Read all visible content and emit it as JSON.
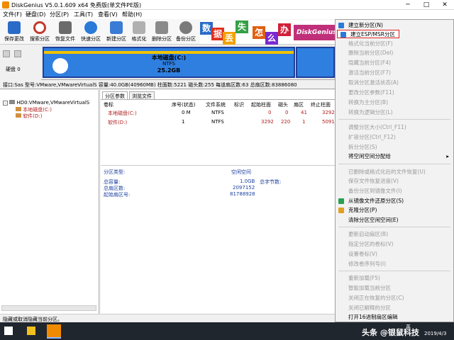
{
  "window": {
    "title": "DiskGenius V5.0.1.609 x64 免费版(单文件PE版)",
    "min": "─",
    "max": "□",
    "close": "✕"
  },
  "menu": [
    "文件(F)",
    "硬盘(D)",
    "分区(P)",
    "工具(T)",
    "查看(V)",
    "帮助(H)"
  ],
  "toolbar": [
    {
      "label": "保存更改",
      "color": "#2a6bc8"
    },
    {
      "label": "搜索分区",
      "color": "#c23a2a"
    },
    {
      "label": "恢复文件",
      "color": "#6b6b6b"
    },
    {
      "label": "快速分区",
      "color": "#2a7ad8"
    },
    {
      "label": "新建分区",
      "color": "#3a7bd5"
    },
    {
      "label": "格式化",
      "color": "#b0b0b0"
    },
    {
      "label": "删除分区",
      "color": "#8a8a8a"
    },
    {
      "label": "备份分区",
      "color": "#7a7a7a"
    }
  ],
  "banner": {
    "chars": [
      "数",
      "据",
      "丢",
      "失",
      "怎",
      "么",
      "办"
    ],
    "colors": [
      "#2a6bc8",
      "#e0301f",
      "#f2a000",
      "#33a047",
      "#e06010",
      "#7a2ad0",
      "#d0203a"
    ],
    "brand": "DiskGenius"
  },
  "disk_panel": {
    "label": "硬盘 0"
  },
  "partition_bar": {
    "name": "本地磁盘(C:)",
    "fs": "NTFS",
    "size": "25.2GB"
  },
  "disk_info": "接口:Sas  型号:VMware,VMwareVirtualS  容量:40.0GB(40960MB)  柱面数:5221  磁头数:255  每道扇区数:63  总扇区数:83886080",
  "tree": {
    "disk": "HD0:VMware,VMwareVirtualS",
    "items": [
      "本地磁盘(C:)",
      "软件(D:)"
    ]
  },
  "tabs": [
    "分区参数",
    "浏览文件"
  ],
  "table": {
    "headers": [
      "卷标",
      "序号(状态)",
      "文件系统",
      "标识",
      "起始柱面",
      "磁头",
      "扇区",
      "终止柱面"
    ],
    "rows": [
      [
        "本地磁盘(C:)",
        "0 M",
        "NTFS",
        "",
        "0",
        "0",
        "41",
        "3292"
      ],
      [
        "软件(D:)",
        "1",
        "NTFS",
        "",
        "3292",
        "220",
        "1",
        "5091"
      ]
    ]
  },
  "details": {
    "type_label": "分区类型:",
    "type_value": "空闲空间",
    "total_label": "总容量:",
    "total_value": "1.0GB",
    "sectors_label": "总扇区数:",
    "sectors_value": "2097152",
    "start_label": "起始扇区号:",
    "start_value": "81788928",
    "bytes_label": "总字节数:"
  },
  "status": "隐藏或取消隐藏当前分区。",
  "context_menu": [
    {
      "label": "建立新分区(N)",
      "disabled": false,
      "icon": "#2a7ad8"
    },
    {
      "label": "建立ESP/MSR分区",
      "disabled": false,
      "icon": "#2a7ad8",
      "highlight": true
    },
    {
      "label": "格式化当前分区(F)",
      "disabled": true
    },
    {
      "label": "删除当前分区(Del)",
      "disabled": true
    },
    {
      "label": "隐藏当前分区(F4)",
      "disabled": true
    },
    {
      "label": "激活当前分区(F7)",
      "disabled": true
    },
    {
      "label": "取消分区激活状态(A)",
      "disabled": true
    },
    {
      "label": "更改分区参数(F11)",
      "disabled": true
    },
    {
      "label": "转换为主分区(B)",
      "disabled": true
    },
    {
      "label": "转换为逻辑分区(L)",
      "disabled": true
    },
    {
      "sep": true
    },
    {
      "label": "调整分区大小(Ctrl_F11)",
      "disabled": true
    },
    {
      "label": "扩容分区(Ctrl_F12)",
      "disabled": true
    },
    {
      "label": "拆分分区(S)",
      "disabled": true
    },
    {
      "label": "将空闲空间分配给",
      "disabled": false,
      "submenu": true
    },
    {
      "sep": true
    },
    {
      "label": "已删除或格式化后的文件恢复(U)",
      "disabled": true
    },
    {
      "label": "保存文件恢复进度(V)",
      "disabled": true
    },
    {
      "label": "备份分区到镜像文件(I)",
      "disabled": true
    },
    {
      "label": "从镜像文件还原分区(S)",
      "disabled": false,
      "icon": "#2aa050"
    },
    {
      "label": "克隆分区(P)",
      "disabled": false,
      "icon": "#e0a020"
    },
    {
      "label": "清除分区空闲空间(E)",
      "disabled": false
    },
    {
      "sep": true
    },
    {
      "label": "更新启动扇区(B)",
      "disabled": true
    },
    {
      "label": "指定分区的卷标(V)",
      "disabled": true
    },
    {
      "label": "设置卷标(V)",
      "disabled": true
    },
    {
      "label": "修改卷序列号(I)",
      "disabled": true
    },
    {
      "sep": true
    },
    {
      "label": "重新加载(F5)",
      "disabled": true
    },
    {
      "label": "智能加载当前分区",
      "disabled": true
    },
    {
      "label": "关闭正在恢复的分区(C)",
      "disabled": true
    },
    {
      "label": "关闭已解释的分区",
      "disabled": true
    },
    {
      "label": "打开16进制扇区编辑",
      "disabled": false
    }
  ],
  "taskbar": {
    "date": "2019/4/3",
    "watermark": "头条 @银鼠科技",
    "lang": "英"
  }
}
